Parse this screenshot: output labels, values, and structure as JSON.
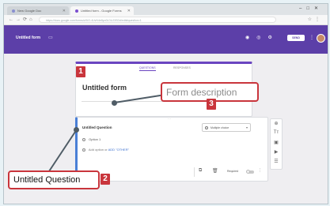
{
  "browser": {
    "tabs": [
      {
        "label": "New Google Doc"
      },
      {
        "label": "Untitled form - Google Forms"
      }
    ],
    "url": "https://docs.google.com/forms/d/1lO-4UvN4e8yo0LDUJ3SDd/edit#question=1"
  },
  "header": {
    "title": "Untitled form",
    "send_label": "SEND"
  },
  "form": {
    "tabs": {
      "questions": "QUESTIONS",
      "responses": "RESPONSES"
    },
    "title": "Untitled form"
  },
  "question": {
    "title": "Untitled Question",
    "type": "Multiple choice",
    "option": "Option 1",
    "add_option": "Add option",
    "or_text": "or",
    "add_other": "ADD \"OTHER\"",
    "required_label": "Required"
  },
  "callouts": {
    "description": "Form description",
    "question": "Untitled Question",
    "badge_1": "1",
    "badge_2": "2",
    "badge_3": "3"
  },
  "colors": {
    "forms_purple": "#5c3fa8",
    "callout_red": "#c9353c",
    "page_bg": "#e8f2f6"
  }
}
